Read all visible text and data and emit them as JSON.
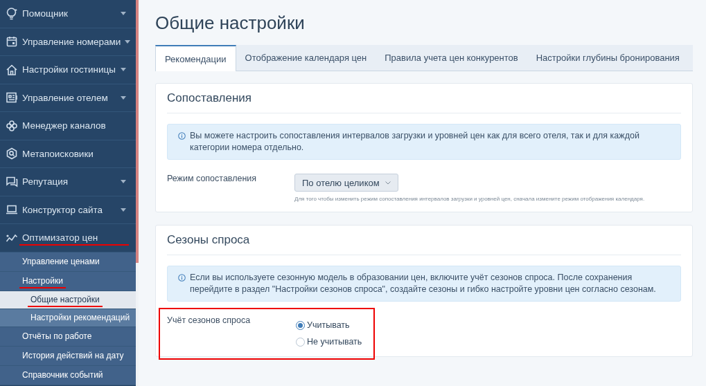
{
  "sidebar": {
    "items": [
      {
        "label": "Помощник",
        "has_caret": true,
        "underlined": false
      },
      {
        "label": "Управление номерами",
        "has_caret": true,
        "underlined": false
      },
      {
        "label": "Настройки гостиницы",
        "has_caret": true,
        "underlined": false
      },
      {
        "label": "Управление отелем",
        "has_caret": true,
        "underlined": false
      },
      {
        "label": "Менеджер каналов",
        "has_caret": false,
        "underlined": false
      },
      {
        "label": "Метапоисковики",
        "has_caret": false,
        "underlined": false
      },
      {
        "label": "Репутация",
        "has_caret": true,
        "underlined": false
      },
      {
        "label": "Конструктор сайта",
        "has_caret": true,
        "underlined": false
      },
      {
        "label": "Оптимизатор цен",
        "has_caret": false,
        "underlined": true,
        "children": [
          {
            "label": "Управление ценами",
            "underlined": false,
            "selected": false
          },
          {
            "label": "Настройки",
            "underlined": true,
            "selected": false,
            "children": [
              {
                "label": "Общие настройки",
                "underlined": true,
                "selected": true
              },
              {
                "label": "Настройки рекомендаций",
                "underlined": false,
                "selected": false
              }
            ]
          },
          {
            "label": "Отчёты по работе",
            "underlined": false,
            "selected": false
          },
          {
            "label": "История действий на дату",
            "underlined": false,
            "selected": false
          },
          {
            "label": "Справочник событий",
            "underlined": false,
            "selected": false
          }
        ]
      }
    ]
  },
  "page": {
    "title": "Общие настройки"
  },
  "tabs": [
    {
      "label": "Рекомендации",
      "selected": true
    },
    {
      "label": "Отображение календаря цен",
      "selected": false
    },
    {
      "label": "Правила учета цен конкурентов",
      "selected": false
    },
    {
      "label": "Настройки глубины бронирования",
      "selected": false
    }
  ],
  "sections": [
    {
      "title": "Сопоставления",
      "info": "Вы можете настроить сопоставления интервалов загрузки и уровней цен как для всего отеля, так и для каждой категории номера отдельно.",
      "field": {
        "kind": "dropdown",
        "label": "Режим сопоставления",
        "value": "По отелю целиком",
        "hint": "Для того чтобы изменить режим сопоставления интервалов загрузки и уровней цен, сначала измените режим отображения календаря.",
        "highlighted": false
      }
    },
    {
      "title": "Сезоны спроса",
      "info": "Если вы используете сезонную модель в образовании цен, включите учёт сезонов спроса. После сохранения перейдите в раздел \"Настройки сезонов спроса\", создайте сезоны и гибко настройте уровни цен согласно сезонам.",
      "field": {
        "kind": "radio",
        "label": "Учёт сезонов спроса",
        "options": [
          {
            "label": "Учитывать",
            "selected": true
          },
          {
            "label": "Не учитывать",
            "selected": false
          }
        ],
        "highlighted": true
      }
    }
  ]
}
